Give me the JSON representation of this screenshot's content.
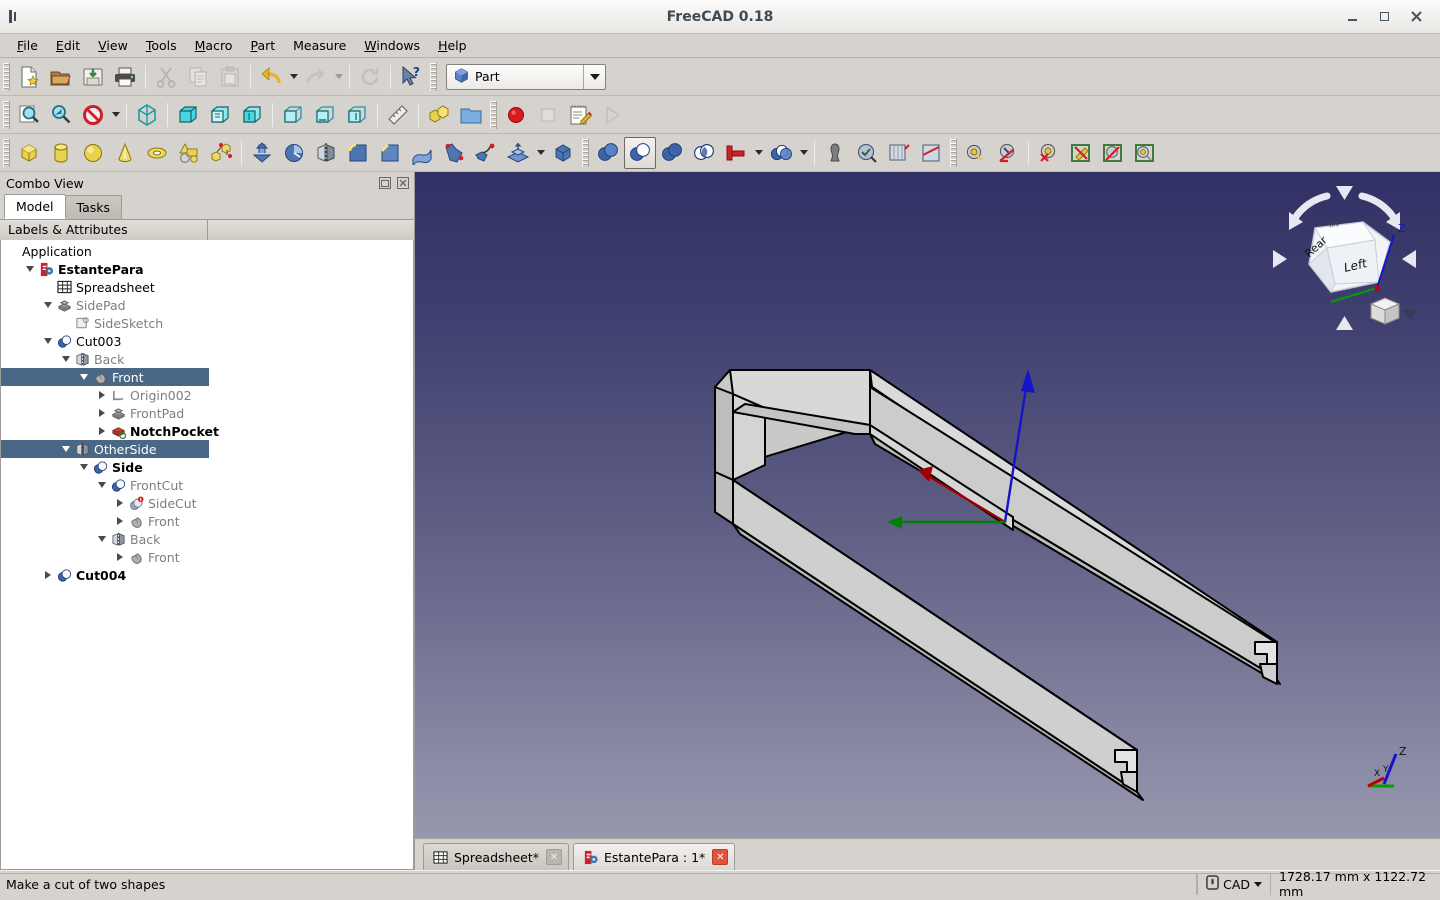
{
  "window": {
    "title": "FreeCAD 0.18",
    "app_icon": "freecad-icon",
    "minimize_label": "–",
    "maximize_label": "□",
    "close_label": "✕"
  },
  "menubar": {
    "items": [
      {
        "label": "File",
        "mnemonic": "F"
      },
      {
        "label": "Edit",
        "mnemonic": "E"
      },
      {
        "label": "View",
        "mnemonic": "V"
      },
      {
        "label": "Tools",
        "mnemonic": "T"
      },
      {
        "label": "Macro",
        "mnemonic": "M"
      },
      {
        "label": "Part",
        "mnemonic": "P"
      },
      {
        "label": "Measure",
        "mnemonic": ""
      },
      {
        "label": "Windows",
        "mnemonic": "W"
      },
      {
        "label": "Help",
        "mnemonic": "H"
      }
    ]
  },
  "workbench": {
    "selected": "Part",
    "icon": "blue-cube-icon"
  },
  "toolbars": {
    "file": [
      {
        "name": "new-document",
        "icon": "new-file-icon",
        "enabled": true
      },
      {
        "name": "open-document",
        "icon": "open-folder-icon",
        "enabled": true
      },
      {
        "name": "save-document",
        "icon": "save-icon",
        "enabled": true
      },
      {
        "name": "print-document",
        "icon": "printer-icon",
        "enabled": true
      },
      {
        "name": "cut",
        "icon": "scissors-icon",
        "enabled": false
      },
      {
        "name": "copy",
        "icon": "copy-icon",
        "enabled": false
      },
      {
        "name": "paste",
        "icon": "clipboard-icon",
        "enabled": false
      },
      {
        "name": "undo",
        "icon": "undo-arrow-icon",
        "enabled": true
      },
      {
        "name": "redo",
        "icon": "redo-arrow-icon",
        "enabled": false
      },
      {
        "name": "refresh",
        "icon": "refresh-icon",
        "enabled": false
      },
      {
        "name": "whats-this",
        "icon": "cursor-question-icon",
        "enabled": true
      }
    ],
    "view": [
      {
        "name": "fit-all",
        "icon": "fit-all-icon",
        "enabled": true
      },
      {
        "name": "fit-selection",
        "icon": "zoom-selection-icon",
        "enabled": true
      },
      {
        "name": "draw-style",
        "icon": "draw-style-icon",
        "enabled": true
      },
      {
        "name": "axonometric-view",
        "icon": "isometric-cube-icon",
        "enabled": true
      },
      {
        "name": "front-view",
        "icon": "front-view-icon",
        "enabled": true
      },
      {
        "name": "top-view",
        "icon": "top-view-icon",
        "enabled": true
      },
      {
        "name": "right-view",
        "icon": "right-view-icon",
        "enabled": true
      },
      {
        "name": "rear-view",
        "icon": "rear-view-icon",
        "enabled": true
      },
      {
        "name": "bottom-view",
        "icon": "bottom-view-icon",
        "enabled": true
      },
      {
        "name": "left-view",
        "icon": "left-view-icon",
        "enabled": true
      },
      {
        "name": "measure",
        "icon": "ruler-icon",
        "enabled": true
      },
      {
        "name": "create-part",
        "icon": "yellow-part-icon",
        "enabled": true
      },
      {
        "name": "create-group",
        "icon": "blue-folder-icon",
        "enabled": true
      },
      {
        "name": "macro-record",
        "icon": "record-circle-icon",
        "enabled": true
      },
      {
        "name": "macro-stop",
        "icon": "stop-square-icon",
        "enabled": false
      },
      {
        "name": "macros-dialog",
        "icon": "notepad-pencil-icon",
        "enabled": true
      },
      {
        "name": "macro-execute",
        "icon": "play-triangle-icon",
        "enabled": false
      }
    ],
    "part": [
      {
        "name": "box-primitive",
        "icon": "yellow-box-icon",
        "enabled": true
      },
      {
        "name": "cylinder-primitive",
        "icon": "yellow-cylinder-icon",
        "enabled": true
      },
      {
        "name": "sphere-primitive",
        "icon": "yellow-sphere-icon",
        "enabled": true
      },
      {
        "name": "cone-primitive",
        "icon": "yellow-cone-icon",
        "enabled": true
      },
      {
        "name": "torus-primitive",
        "icon": "yellow-torus-icon",
        "enabled": true
      },
      {
        "name": "create-primitives",
        "icon": "primitives-icon",
        "enabled": true
      },
      {
        "name": "shape-builder",
        "icon": "shape-builder-icon",
        "enabled": true
      },
      {
        "name": "extrude",
        "icon": "extrude-icon",
        "enabled": true
      },
      {
        "name": "revolve",
        "icon": "revolve-icon",
        "enabled": true
      },
      {
        "name": "mirror",
        "icon": "mirror-icon",
        "enabled": true
      },
      {
        "name": "fillet",
        "icon": "fillet-icon",
        "enabled": true
      },
      {
        "name": "chamfer",
        "icon": "chamfer-icon",
        "enabled": true
      },
      {
        "name": "ruled-surface",
        "icon": "ruled-surface-icon",
        "enabled": true
      },
      {
        "name": "loft",
        "icon": "loft-icon",
        "enabled": true
      },
      {
        "name": "sweep",
        "icon": "sweep-icon",
        "enabled": true
      },
      {
        "name": "offset",
        "icon": "offset-icon",
        "enabled": true
      },
      {
        "name": "thickness",
        "icon": "thickness-icon",
        "enabled": true
      },
      {
        "name": "boolean",
        "icon": "boolean-icon",
        "enabled": true
      },
      {
        "name": "cut",
        "icon": "boolean-cut-icon",
        "enabled": true,
        "pressed": true
      },
      {
        "name": "union",
        "icon": "boolean-union-icon",
        "enabled": true
      },
      {
        "name": "intersection",
        "icon": "boolean-intersection-icon",
        "enabled": true
      },
      {
        "name": "join-connect",
        "icon": "join-connect-icon",
        "enabled": true
      },
      {
        "name": "split-boolean",
        "icon": "split-boolean-icon",
        "enabled": true
      },
      {
        "name": "compound-tools",
        "icon": "compound-icon",
        "enabled": true
      },
      {
        "name": "check-geometry",
        "icon": "check-geometry-icon",
        "enabled": true
      },
      {
        "name": "cross-sections",
        "icon": "cross-sections-icon",
        "enabled": true
      },
      {
        "name": "measure-linear",
        "icon": "measure-linear-icon",
        "enabled": true
      },
      {
        "name": "measure-angular",
        "icon": "measure-angular-icon",
        "enabled": true
      },
      {
        "name": "measure-refresh",
        "icon": "measure-refresh-icon",
        "enabled": true
      },
      {
        "name": "measure-clear-all",
        "icon": "measure-clear-icon",
        "enabled": true
      },
      {
        "name": "measure-toggle-all",
        "icon": "measure-toggle-all-icon",
        "enabled": true
      },
      {
        "name": "measure-toggle-delta",
        "icon": "measure-toggle-delta-icon",
        "enabled": true
      },
      {
        "name": "measure-toggle-3d",
        "icon": "measure-toggle-3d-icon",
        "enabled": true
      }
    ]
  },
  "combo_view": {
    "title": "Combo View",
    "float_button": "float-icon",
    "close_button": "close-icon",
    "tabs": [
      {
        "label": "Model",
        "selected": true
      },
      {
        "label": "Tasks",
        "selected": false
      }
    ],
    "column_header": "Labels & Attributes",
    "tree": [
      {
        "label": "Application",
        "depth": 0,
        "arrow": "none",
        "icon": "none",
        "style": "normal",
        "selected": false
      },
      {
        "label": "EstantePara",
        "depth": 1,
        "arrow": "down",
        "icon": "document-icon",
        "style": "bold",
        "selected": false
      },
      {
        "label": "Spreadsheet",
        "depth": 2,
        "arrow": "none",
        "icon": "spreadsheet-icon",
        "style": "normal",
        "selected": false
      },
      {
        "label": "SidePad",
        "depth": 2,
        "arrow": "down",
        "icon": "pad-icon",
        "style": "gray",
        "selected": false
      },
      {
        "label": "SideSketch",
        "depth": 3,
        "arrow": "none",
        "icon": "sketch-icon",
        "style": "gray",
        "selected": false
      },
      {
        "label": "Cut003",
        "depth": 2,
        "arrow": "down",
        "icon": "boolean-cut-icon",
        "style": "normal",
        "selected": false
      },
      {
        "label": "Back",
        "depth": 3,
        "arrow": "down",
        "icon": "mirror-icon",
        "style": "gray",
        "selected": false
      },
      {
        "label": "Front",
        "depth": 4,
        "arrow": "down",
        "icon": "body-icon",
        "style": "normal",
        "selected": true
      },
      {
        "label": "Origin002",
        "depth": 5,
        "arrow": "right",
        "icon": "origin-icon",
        "style": "gray",
        "selected": false
      },
      {
        "label": "FrontPad",
        "depth": 5,
        "arrow": "right",
        "icon": "pad-icon",
        "style": "gray",
        "selected": false
      },
      {
        "label": "NotchPocket",
        "depth": 5,
        "arrow": "right",
        "icon": "pocket-icon",
        "style": "bold",
        "selected": false
      },
      {
        "label": "OtherSide",
        "depth": 3,
        "arrow": "down",
        "icon": "mirror-icon",
        "style": "normal",
        "selected": true
      },
      {
        "label": "Side",
        "depth": 4,
        "arrow": "down",
        "icon": "boolean-cut-icon",
        "style": "bold",
        "selected": false
      },
      {
        "label": "FrontCut",
        "depth": 5,
        "arrow": "down",
        "icon": "boolean-cut-icon",
        "style": "gray",
        "selected": false
      },
      {
        "label": "SideCut",
        "depth": 6,
        "arrow": "right",
        "icon": "boolean-cut-error-icon",
        "style": "gray",
        "selected": false
      },
      {
        "label": "Front",
        "depth": 6,
        "arrow": "right",
        "icon": "body-icon",
        "style": "gray",
        "selected": false
      },
      {
        "label": "Back",
        "depth": 5,
        "arrow": "down",
        "icon": "mirror-icon",
        "style": "gray",
        "selected": false
      },
      {
        "label": "Front",
        "depth": 6,
        "arrow": "right",
        "icon": "body-icon",
        "style": "gray",
        "selected": false
      },
      {
        "label": "Cut004",
        "depth": 2,
        "arrow": "right",
        "icon": "boolean-cut-icon",
        "style": "bold",
        "selected": false
      }
    ]
  },
  "view3d": {
    "background_top": "#313166",
    "background_bottom": "#9c9cb2",
    "model_fill": "#d2d2d2",
    "model_edge": "#000000",
    "axis_x_color": "#a00000",
    "axis_y_color": "#008000",
    "axis_z_color": "#0000c0",
    "navcube": {
      "face_front": "Rear",
      "face_right": "Left",
      "face_top": "Top",
      "axis_label_z": "Z",
      "arrow_up": "nav-arrow-up",
      "arrow_down": "nav-arrow-down",
      "arrow_left": "nav-arrow-left",
      "arrow_right": "nav-arrow-right",
      "rotate_left": "nav-rotate-ccw",
      "rotate_right": "nav-rotate-cw",
      "home_cube": "nav-home-cube"
    },
    "mini_axis": {
      "x": "X",
      "y": "Y",
      "z": "Z"
    },
    "tabs": [
      {
        "label": "Spreadsheet*",
        "icon": "spreadsheet-icon",
        "selected": false,
        "close_style": "gray"
      },
      {
        "label": "EstantePara : 1*",
        "icon": "freecad-doc-icon",
        "selected": true,
        "close_style": "red"
      }
    ]
  },
  "statusbar": {
    "message": "Make a cut of two shapes",
    "nav_style": "CAD",
    "nav_icon": "nav-lock-icon",
    "dimensions": "1728.17 mm x 1122.72 mm"
  }
}
